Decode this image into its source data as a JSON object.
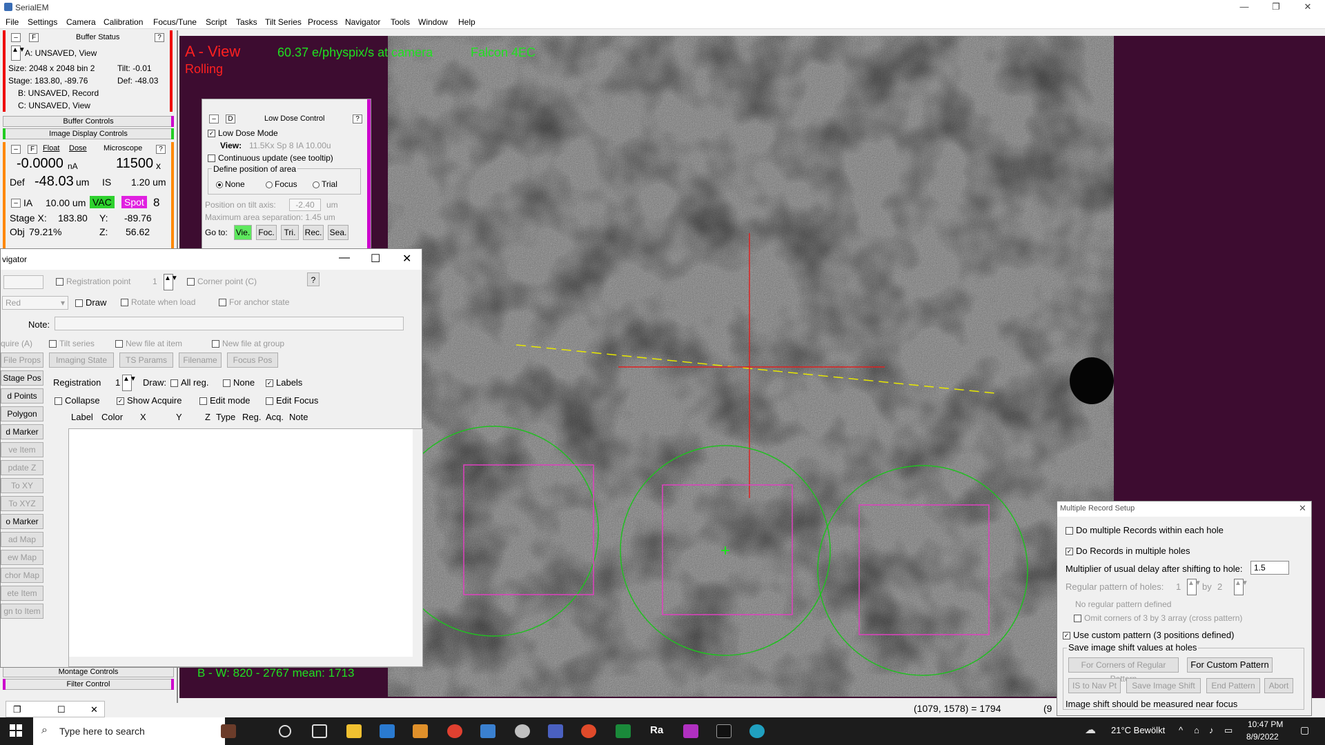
{
  "app": {
    "title": "SerialEM"
  },
  "window": {
    "minimize": "—",
    "restore": "❐",
    "close": "✕"
  },
  "menu": [
    "File",
    "Settings",
    "Camera",
    "Calibration",
    "Focus/Tune",
    "Script",
    "Tasks",
    "Tilt Series",
    "Process",
    "Navigator",
    "Tools",
    "Window",
    "Help"
  ],
  "buffer_status": {
    "header": "Buffer Status",
    "help": "?",
    "a_line": "A: UNSAVED, View",
    "size": "Size: 2048 x 2048  bin 2",
    "tilt": "Tilt: -0.01",
    "stage": "Stage: 183.80, -89.76",
    "def": "Def: -48.03",
    "b_line": "B: UNSAVED, Record",
    "c_line": "C: UNSAVED, View"
  },
  "buffer_controls": {
    "header": "Buffer Controls"
  },
  "image_display": {
    "header": "Image Display Controls"
  },
  "microscope": {
    "float_btn": "Float",
    "dose_btn": "Dose",
    "header": "Microscope",
    "current": "-0.0000",
    "current_unit": "nA",
    "mag": "11500",
    "mag_unit": "x",
    "def_label": "Def",
    "def_value": "-48.03",
    "def_unit": "um",
    "is_label": "IS",
    "is_value": "1.20 um",
    "ia_label": "IA",
    "ia_value": "10.00 um",
    "vac": "VAC",
    "spot_label": "Spot",
    "spot_value": "8",
    "stagex_label": "Stage X:",
    "stagex": "183.80",
    "y_label": "Y:",
    "y": "-89.76",
    "obj_label": "Obj",
    "obj": "79.21%",
    "z_label": "Z:",
    "z": "56.62"
  },
  "montage_controls": {
    "header": "Montage Controls"
  },
  "filter_control": {
    "header": "Filter Control"
  },
  "panel_btns": {
    "minus": "–",
    "plus": "+",
    "f": "F",
    "help": "?"
  },
  "overlay": {
    "a_view": "A - View",
    "rolling": "Rolling",
    "dose_rate": "60.37 e/physpix/s at camera",
    "camera": "Falcon 4EC",
    "b_stats": "B - W: 820 - 2767  mean: 1713"
  },
  "low_dose": {
    "header": "Low Dose Control",
    "d_btn": "D",
    "mode": "Low Dose Mode",
    "view_label": "View:",
    "view_params": "11.5Kx   Sp 8   IA 10.00u",
    "continuous": "Continuous update (see tooltip)",
    "define_group": "Define position of area",
    "radios": [
      "None",
      "Focus",
      "Trial"
    ],
    "pos_tilt_label": "Position on tilt axis:",
    "pos_tilt_value": "-2.40",
    "pos_tilt_unit": "um",
    "max_sep": "Maximum area separation: 1.45 um",
    "goto": "Go to:",
    "goto_btns": [
      "Vie.",
      "Foc.",
      "Tri.",
      "Rec.",
      "Sea."
    ]
  },
  "navigator": {
    "title": "vigator",
    "reg_point": "Registration point",
    "reg_num": "1",
    "corner": "Corner point (C)",
    "color": "Red",
    "draw": "Draw",
    "rotate": "Rotate when load",
    "anchor": "For anchor state",
    "note_label": "Note:",
    "acquire": "quire (A)",
    "tilt_series": "Tilt series",
    "new_file_item": "New file at item",
    "new_file_group": "New file at group",
    "file_props": "File Props",
    "imaging_state": "Imaging State",
    "ts_params": "TS Params",
    "filename": "Filename",
    "focus_pos": "Focus Pos",
    "side_btns": [
      "Stage Pos",
      "d Points",
      "Polygon",
      "d Marker",
      "ve Item",
      "pdate Z",
      "To XY",
      "To XYZ",
      "o Marker",
      "ad Map",
      "ew Map",
      "chor Map",
      "ete Item",
      "gn to Item"
    ],
    "registration_label": "Registration",
    "registration_val": "1",
    "draw_label": "Draw:",
    "all_reg": "All reg.",
    "none": "None",
    "labels": "Labels",
    "collapse": "Collapse",
    "show_acquire": "Show Acquire",
    "edit_mode": "Edit mode",
    "edit_focus": "Edit Focus",
    "columns": [
      "Label",
      "Color",
      "X",
      "Y",
      "Z",
      "Type",
      "Reg.",
      "Acq.",
      "Note"
    ]
  },
  "multi_record": {
    "title": "Multiple Record Setup",
    "within_hole": "Do multiple Records within each hole",
    "in_holes": "Do Records in multiple holes",
    "delay_label": "Multiplier of usual delay after shifting to hole:",
    "delay_value": "1.5",
    "regular_label": "Regular pattern of holes:",
    "reg_x": "1",
    "by": "by",
    "reg_y": "2",
    "no_regular": "No regular pattern defined",
    "omit": "Omit corners of 3 by 3 array (cross pattern)",
    "custom": "Use custom pattern (3 positions defined)",
    "save_group": "Save image shift values at holes",
    "for_corners": "For Corners of Regular Pattern",
    "for_custom": "For Custom Pattern",
    "is_nav": "IS to Nav Pt",
    "save_shift": "Save Image Shift",
    "end_pattern": "End Pattern",
    "abort": "Abort",
    "note": "Image shift should be measured near focus"
  },
  "statusbar": {
    "coords": "(1079, 1578) = 1794",
    "partial": "(9"
  },
  "taskbar": {
    "search": "Type here to search",
    "app_ra": "Ra",
    "weather": "21°C  Bewölkt",
    "time": "10:47 PM",
    "date": "8/9/2022"
  },
  "colors": {
    "dark_bg": "#3d0c30",
    "accent_red": "#ff2020",
    "accent_green": "#20ff20",
    "magenta": "#e040c0"
  }
}
